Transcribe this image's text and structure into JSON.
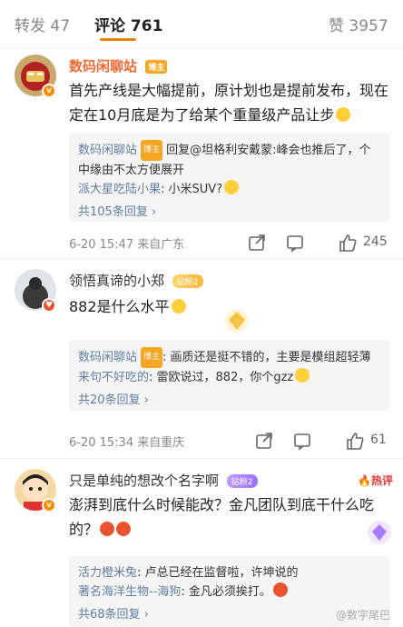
{
  "tabs": {
    "repost": "转发 47",
    "comments": "评论 761",
    "likes": "赞 3957"
  },
  "comments": [
    {
      "user": "数码闲聊站",
      "badge": "博主",
      "text_1": "首先产线是大幅提前，原计划也是提前发布，现在",
      "text_2": "定在10月底是为了给某个重量级产品让步",
      "replies": [
        {
          "name": "数码闲聊站",
          "text": " 回复@坦格利安戴蒙:峰会也推后了，个中缘由不太方便展开"
        },
        {
          "name": "派大星吃陆小果",
          "text": ": 小米SUV?"
        }
      ],
      "more": "共105条回复 ›",
      "time": "6-20 15:47  来自广东",
      "like_count": "245"
    },
    {
      "user": "领悟真谛的小郑",
      "badge": "钻粉2",
      "text_1": "882是什么水平",
      "replies": [
        {
          "name": "数码闲聊站",
          "badge": "博主",
          "text": ": 画质还是挺不错的，主要是模组超轻薄"
        },
        {
          "name": "来句不好吃的",
          "text": ": 雷欧说过，882，你个gzz"
        }
      ],
      "more": "共20条回复 ›",
      "time": "6-20 15:34  来自重庆",
      "like_count": "61"
    },
    {
      "user": "只是单纯的想改个名字啊",
      "badge": "钻粉2",
      "hot": "热评",
      "text_1": "澎湃到底什么时候能改？金凡团队到底干什么吃",
      "text_2": "的？",
      "replies": [
        {
          "name": "活力橙米兔",
          "text": ": 卢总已经在监督啦，许坤说的"
        },
        {
          "name": "著名海洋生物--海狗",
          "text": ": 金凡必须挨打。"
        }
      ],
      "more": "共68条回复 ›"
    }
  ],
  "watermark": "@数字尾巴",
  "colors": {
    "accent": "#f08200",
    "vip_name": "#f06a32",
    "link": "#5f7ea6",
    "hot": "#ee3333"
  }
}
